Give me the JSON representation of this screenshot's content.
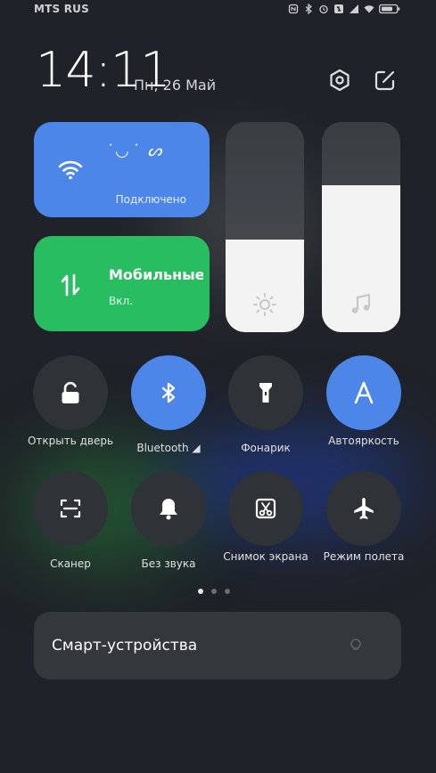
{
  "status_bar": {
    "carrier": "MTS RUS",
    "icons": [
      "nfc-icon",
      "bluetooth-icon",
      "alarm-icon",
      "silent-icon",
      "signal-icon",
      "wifi-icon",
      "battery-icon"
    ]
  },
  "header": {
    "time": "14:11",
    "date": "Пн, 26 Май",
    "icons": [
      "settings-icon",
      "edit-icon"
    ]
  },
  "tiles": {
    "wifi": {
      "network_name": "˙◡˙ ᔕ",
      "status": "Подключено",
      "icon": "wifi-icon",
      "on": true
    },
    "mobile": {
      "title": "Мобильные",
      "status": "Вкл.",
      "icon": "mobile-data-icon",
      "on": true
    }
  },
  "sliders": {
    "brightness": {
      "level": 0.44,
      "icon": "brightness-icon"
    },
    "volume": {
      "level": 0.7,
      "icon": "music-note-icon"
    }
  },
  "quick_settings": [
    {
      "label": "Открыть дверь",
      "icon": "lock-open-icon",
      "on": false
    },
    {
      "label": "Bluetooth ◢",
      "icon": "bluetooth-icon",
      "on": true
    },
    {
      "label": "Фонарик",
      "icon": "flashlight-icon",
      "on": false
    },
    {
      "label": "Автояркость",
      "icon": "auto-brightness-icon",
      "on": true
    },
    {
      "label": "Сканер",
      "icon": "scanner-icon",
      "on": false
    },
    {
      "label": "Без звука",
      "icon": "bell-icon",
      "on": false
    },
    {
      "label": "Снимок экрана",
      "icon": "screenshot-icon",
      "on": false
    },
    {
      "label": "Режим полета",
      "icon": "airplane-icon",
      "on": false
    }
  ],
  "pager": {
    "pages": 3,
    "active": 1
  },
  "smart_devices": {
    "label": "Смарт-устройства"
  },
  "colors": {
    "accent_blue": "#4c86e8",
    "accent_green": "#27bd60",
    "tile_off": "#2f3237"
  }
}
